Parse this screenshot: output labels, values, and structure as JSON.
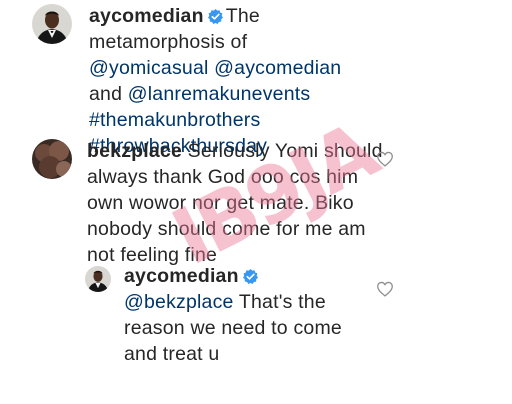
{
  "post": {
    "username": "aycomedian",
    "caption_text": "The metamorphosis of",
    "mentions": [
      "@yomicasual",
      "@aycomedian"
    ],
    "and_word": "and",
    "mention_last": "@lanremakunevents",
    "hashtags": [
      "#themakunbrothers",
      "#throwbackthursday"
    ]
  },
  "comments": [
    {
      "username": "bekzplace",
      "text": "Seriously Yomi should always thank God ooo cos him own wowor nor get mate. Biko nobody should come for me am not feeling fine"
    }
  ],
  "reply": {
    "username": "aycomedian",
    "mention": "@bekzplace",
    "text": "That's the reason we need to come and treat u"
  },
  "watermark": {
    "text": "IB9JA"
  },
  "colors": {
    "link": "#003569",
    "verified": "#3897f0",
    "text": "#262626",
    "watermark": "#ec7896"
  },
  "icons": [
    "verified-badge-icon",
    "heart-icon"
  ]
}
